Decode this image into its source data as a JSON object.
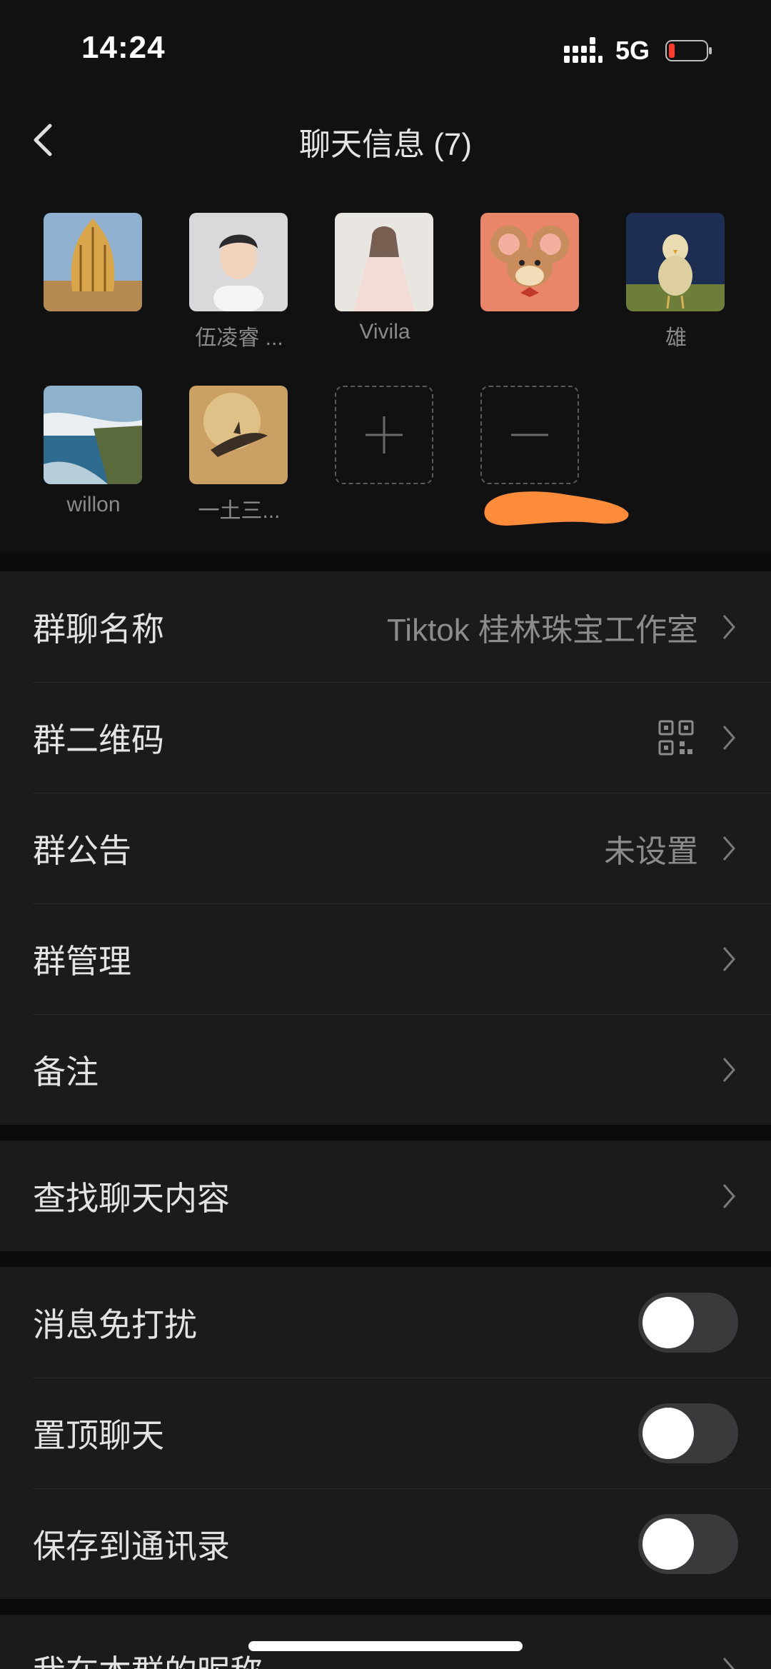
{
  "status_bar": {
    "time": "14:24",
    "network": "5G"
  },
  "nav": {
    "title": "聊天信息 (7)"
  },
  "members": [
    {
      "name": ""
    },
    {
      "name": "伍凌睿 ..."
    },
    {
      "name": "Vivila"
    },
    {
      "name": ""
    },
    {
      "name": "雄"
    },
    {
      "name": "willon"
    },
    {
      "name": "一土三..."
    }
  ],
  "group_info": {
    "name_label": "群聊名称",
    "name_value": "Tiktok 桂林珠宝工作室",
    "qrcode_label": "群二维码",
    "notice_label": "群公告",
    "notice_value": "未设置",
    "manage_label": "群管理",
    "remark_label": "备注"
  },
  "search": {
    "label": "查找聊天内容"
  },
  "settings": {
    "mute_label": "消息免打扰",
    "pin_label": "置顶聊天",
    "save_label": "保存到通讯录",
    "mute_on": false,
    "pin_on": false,
    "save_on": false
  },
  "partial": {
    "nickname_label": "我在本群的昵称"
  },
  "colors": {
    "background": "#111111",
    "group_bg": "#1b1b1b",
    "toggle_off": "#3a3a3c",
    "battery_low": "#ff3b30",
    "redaction": "#ff8c3a"
  }
}
